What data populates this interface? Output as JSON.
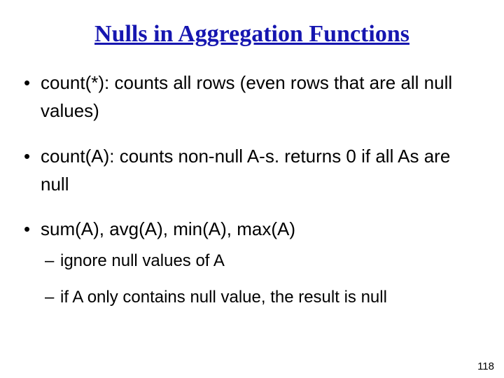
{
  "title": "Nulls in Aggregation Functions",
  "bullets": [
    {
      "text": "count(*): counts all rows (even rows that are all null values)"
    },
    {
      "text": "count(A): counts non-null A-s. returns 0 if all As are null"
    },
    {
      "text": "sum(A), avg(A), min(A), max(A)",
      "sub": [
        "ignore null values of A",
        "if A only contains null value, the result is null"
      ]
    }
  ],
  "page_number": "118"
}
